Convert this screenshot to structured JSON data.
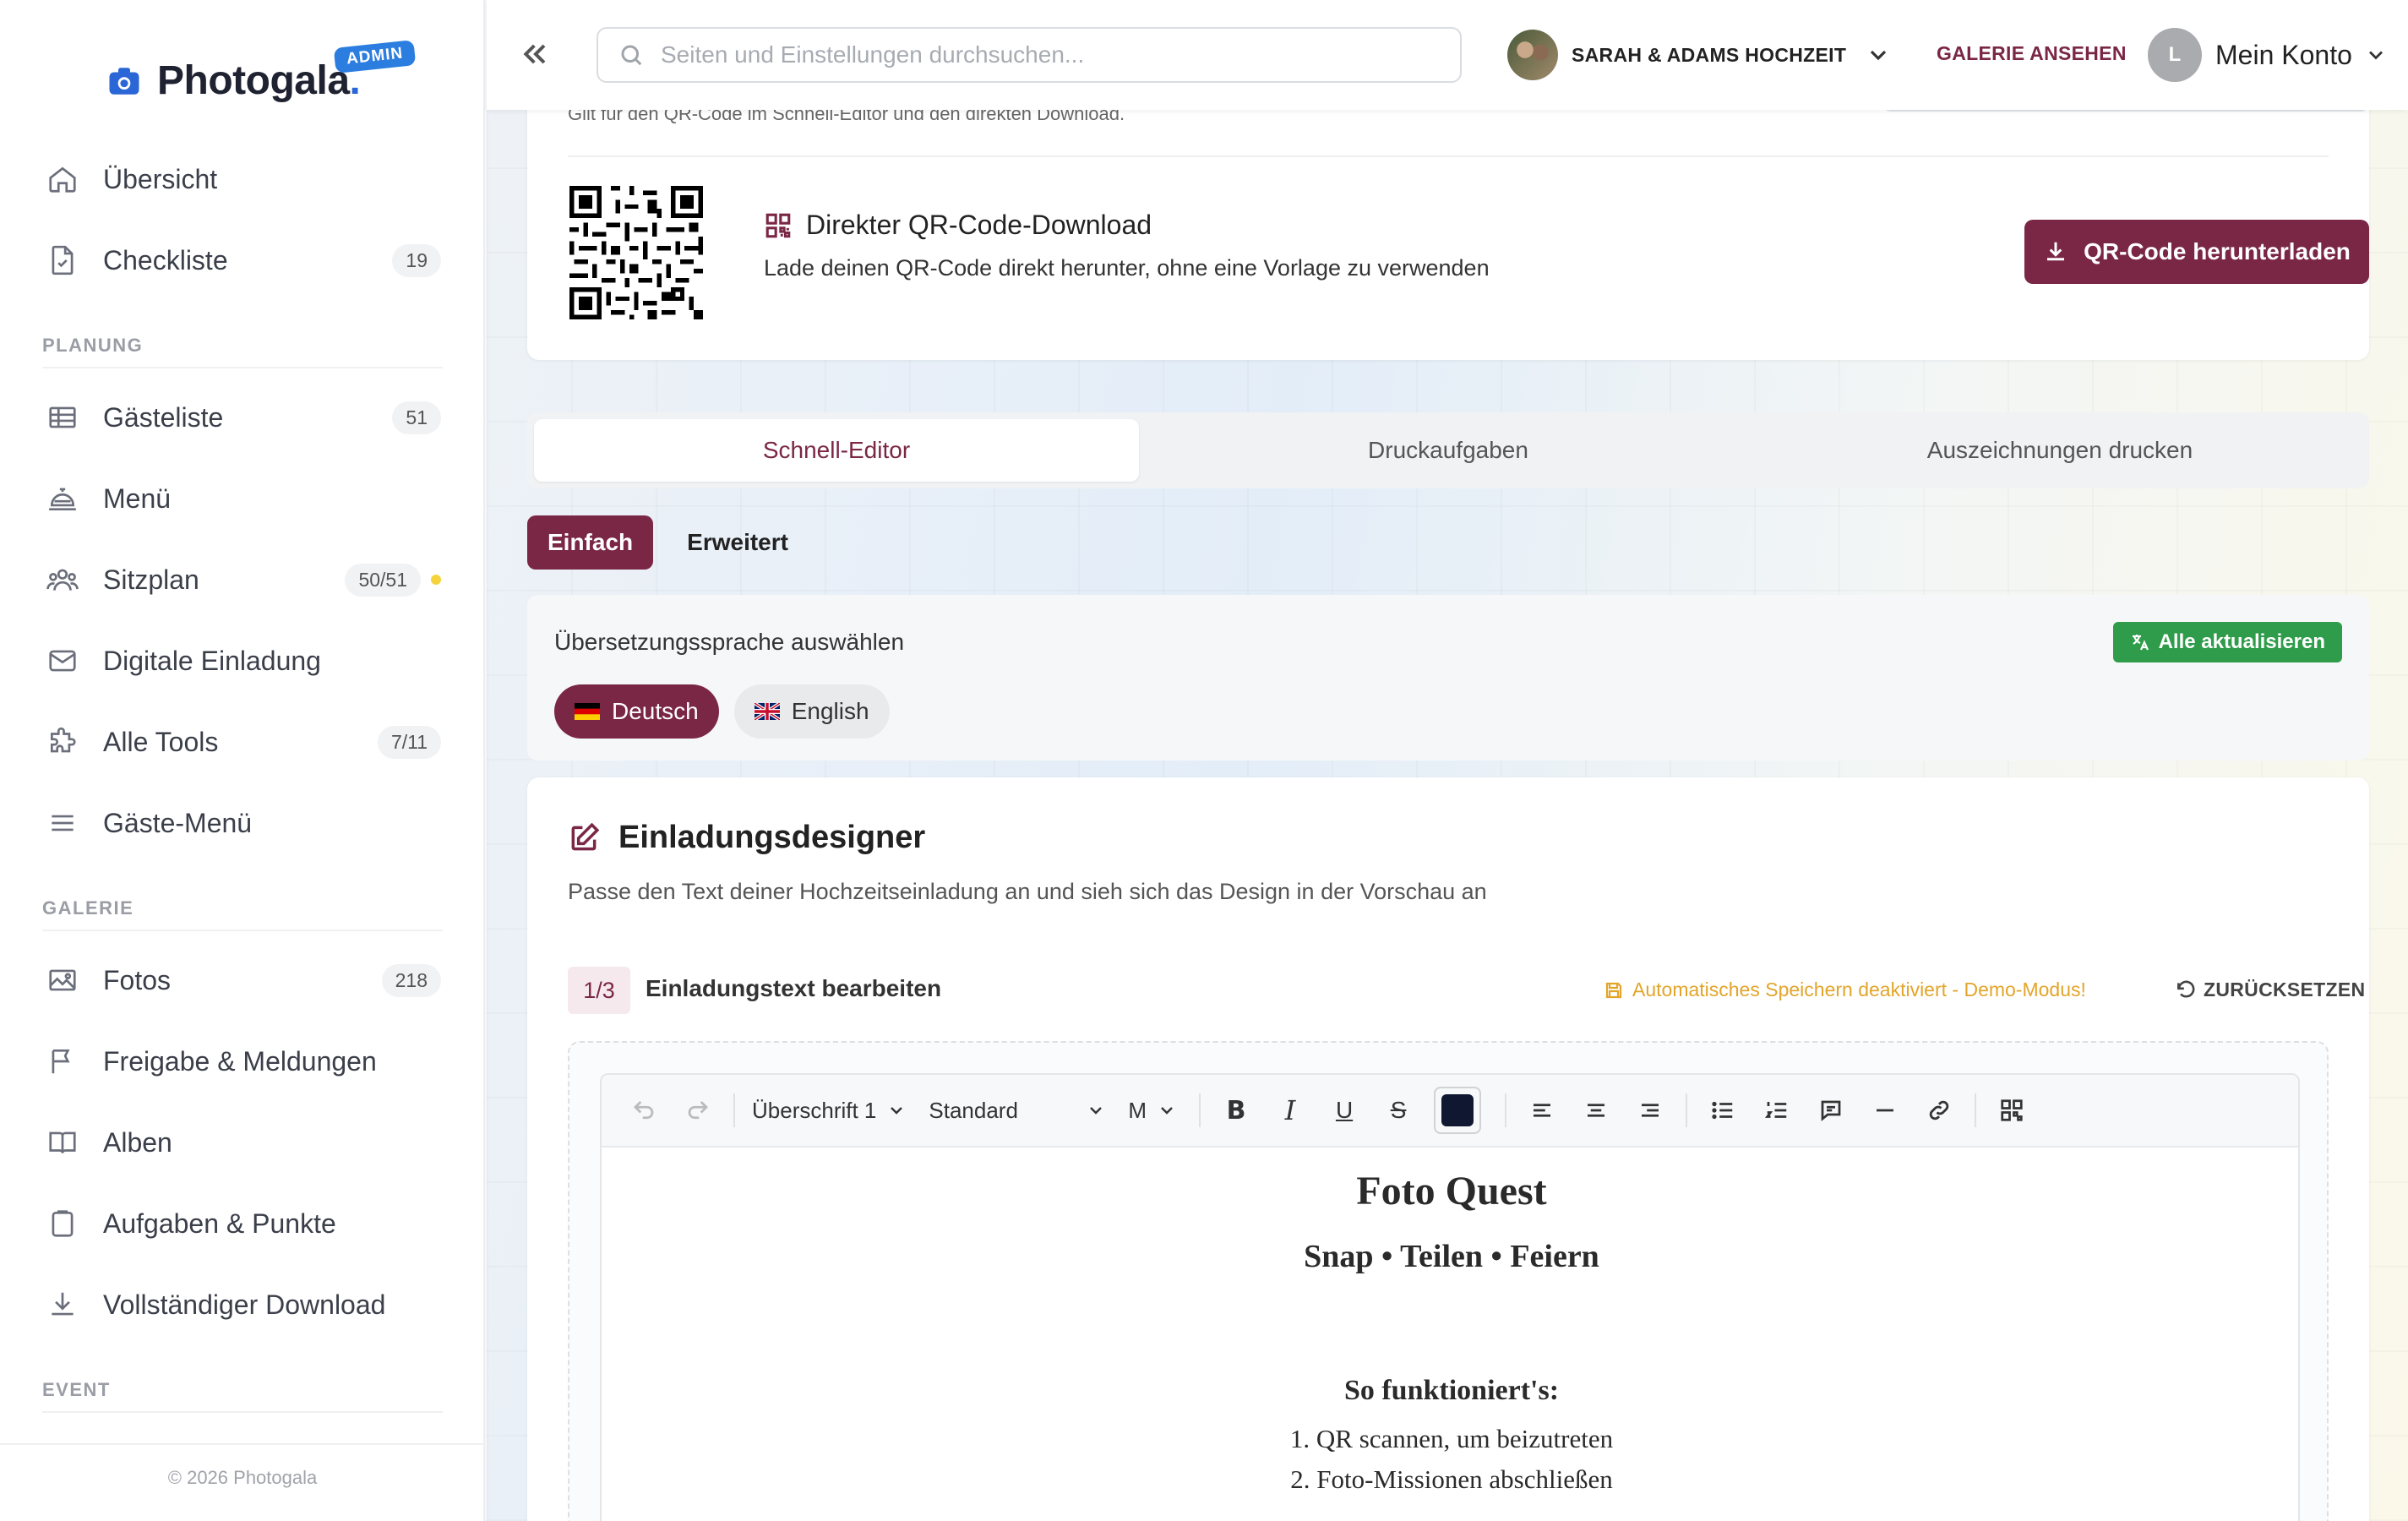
{
  "brand": {
    "name": "Photogala",
    "dot": ".",
    "badge": "ADMIN"
  },
  "sidebar": {
    "items": [
      {
        "label": "Übersicht",
        "icon": "home-icon"
      },
      {
        "label": "Checkliste",
        "icon": "checklist-icon",
        "count": "19"
      },
      {
        "label": "Gästeliste",
        "icon": "table-icon",
        "count": "51"
      },
      {
        "label": "Menü",
        "icon": "cloche-icon"
      },
      {
        "label": "Sitzplan",
        "icon": "people-icon",
        "count": "50/51"
      },
      {
        "label": "Digitale Einladung",
        "icon": "mail-icon"
      },
      {
        "label": "Alle Tools",
        "icon": "puzzle-icon",
        "count": "7/11"
      },
      {
        "label": "Gäste-Menü",
        "icon": "menu-lines-icon"
      },
      {
        "label": "Fotos",
        "icon": "image-icon",
        "count": "218"
      },
      {
        "label": "Freigabe & Meldungen",
        "icon": "flag-icon"
      },
      {
        "label": "Alben",
        "icon": "book-icon"
      },
      {
        "label": "Aufgaben & Punkte",
        "icon": "clipboard-icon"
      },
      {
        "label": "Vollständiger Download",
        "icon": "download-icon"
      }
    ],
    "sections": {
      "planung": "PLANUNG",
      "galerie": "GALERIE",
      "event": "EVENT"
    },
    "copyright": "© 2026 Photogala"
  },
  "header": {
    "search_placeholder": "Seiten und Einstellungen durchsuchen...",
    "event_name": "SARAH & ADAMS HOCHZEIT",
    "gallery_link": "GALERIE ANSEHEN",
    "account_initial": "L",
    "account_label": "Mein Konto"
  },
  "qr": {
    "cut_text": "Gilt für den QR-Code im Schnell-Editor und den direkten Download.",
    "title": "Direkter QR-Code-Download",
    "description": "Lade deinen QR-Code direkt herunter, ohne eine Vorlage zu verwenden",
    "button": "QR-Code herunterladen"
  },
  "tabs": [
    {
      "label": "Schnell-Editor",
      "active": true
    },
    {
      "label": "Druckaufgaben",
      "active": false
    },
    {
      "label": "Auszeichnungen drucken",
      "active": false
    }
  ],
  "sub_tabs": [
    {
      "label": "Einfach",
      "active": true
    },
    {
      "label": "Erweitert",
      "active": false
    }
  ],
  "language": {
    "title": "Übersetzungssprache auswählen",
    "update_all": "Alle aktualisieren",
    "options": [
      {
        "label": "Deutsch",
        "active": true
      },
      {
        "label": "English",
        "active": false
      }
    ]
  },
  "designer": {
    "title": "Einladungsdesigner",
    "description": "Passe den Text deiner Hochzeitseinladung an und sieh sich das Design in der Vorschau an",
    "step": "1/3",
    "step_title": "Einladungstext bearbeiten",
    "autosave": "Automatisches Speichern deaktiviert - Demo-Modus!",
    "reset": "ZURÜCKSETZEN"
  },
  "toolbar": {
    "heading": "Überschrift 1",
    "font": "Standard",
    "size": "M",
    "bold": "B",
    "italic": "I",
    "underline": "U",
    "strike": "S",
    "text_color": "#0f1830"
  },
  "document": {
    "title": "Foto Quest",
    "subtitle": "Snap • Teilen • Feiern",
    "section": "So funktioniert's:",
    "steps": [
      "1. QR scannen, um beizutreten",
      "2. Foto-Missionen abschließen"
    ]
  },
  "colors": {
    "accent": "#7a2745",
    "brand_blue": "#2b66d6",
    "success": "#2e9c4a",
    "warning": "#e2a52a",
    "status_dot": "#f5d33a"
  }
}
